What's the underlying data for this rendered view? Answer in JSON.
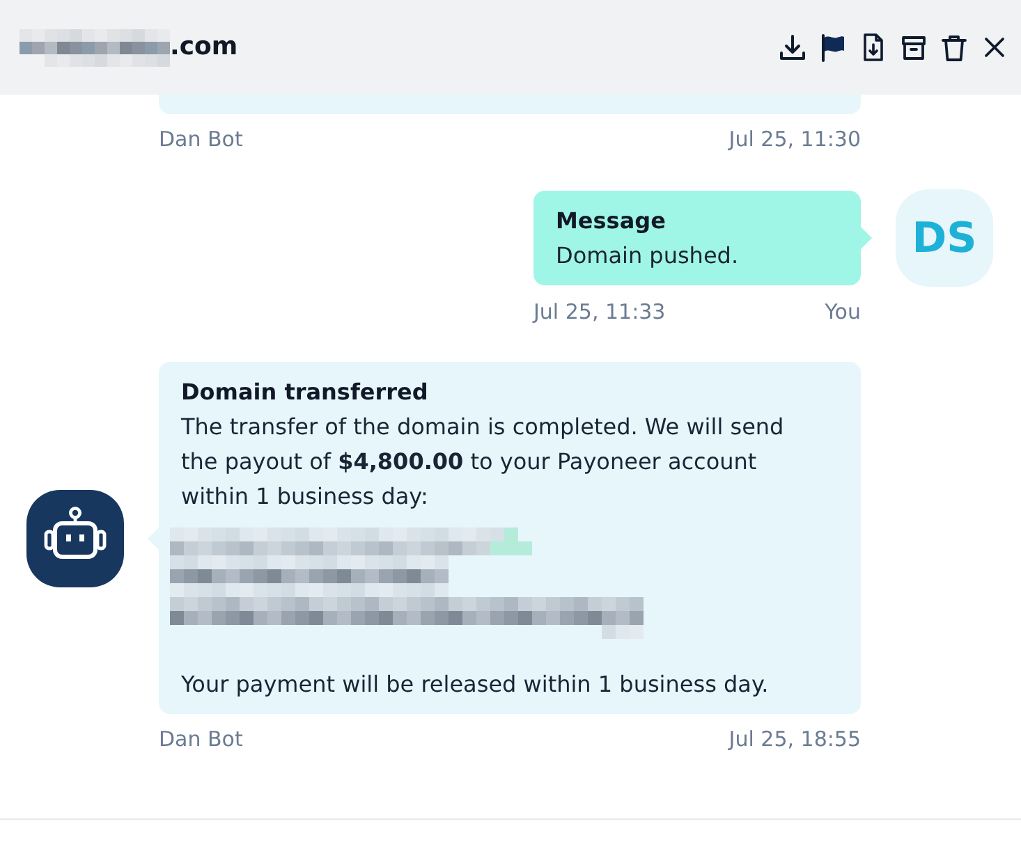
{
  "header": {
    "title_parts": [
      {
        "kind": "redacted"
      },
      {
        "kind": "text",
        "text": ".com"
      }
    ]
  },
  "messages": [
    {
      "kind": "bot",
      "clipped": true,
      "sender": "Dan Bot",
      "time": "Jul 25, 11:30"
    },
    {
      "kind": "user",
      "clipped": false,
      "avatar": {
        "kind": "initials",
        "initials": "DS"
      },
      "title": "Message",
      "body": [
        {
          "kind": "text",
          "text": "Domain pushed."
        }
      ],
      "time": "Jul 25, 11:33",
      "sender": "You"
    },
    {
      "kind": "bot",
      "clipped": false,
      "avatar": {
        "kind": "robot"
      },
      "title": "Domain transferred",
      "body": [
        {
          "kind": "text",
          "text": "The transfer of the domain is completed. We will send the payout of **$4,800.00** to your Payoneer account within 1 business day:"
        },
        {
          "kind": "redacted"
        },
        {
          "kind": "text",
          "text": "Your payment will be released within 1 business day."
        }
      ],
      "sender": "Dan Bot",
      "time": "Jul 25, 18:55"
    }
  ]
}
